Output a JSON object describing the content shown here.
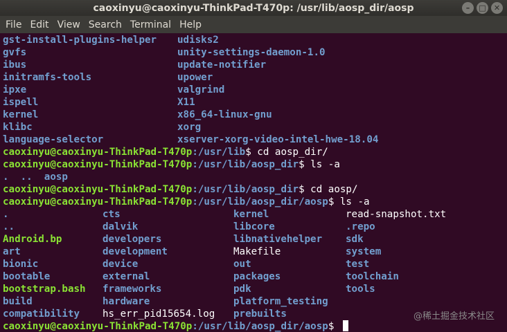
{
  "window": {
    "title": "caoxinyu@caoxinyu-ThinkPad-T470p: /usr/lib/aosp_dir/aosp",
    "buttons": [
      "–",
      "□",
      "✕"
    ]
  },
  "menubar": [
    "File",
    "Edit",
    "View",
    "Search",
    "Terminal",
    "Help"
  ],
  "listing1": [
    [
      "gst-install-plugins-helper",
      "udisks2"
    ],
    [
      "gvfs",
      "unity-settings-daemon-1.0"
    ],
    [
      "ibus",
      "update-notifier"
    ],
    [
      "initramfs-tools",
      "upower"
    ],
    [
      "ipxe",
      "valgrind"
    ],
    [
      "ispell",
      "X11"
    ],
    [
      "kernel",
      "x86_64-linux-gnu"
    ],
    [
      "klibc",
      "xorg"
    ],
    [
      "language-selector",
      "xserver-xorg-video-intel-hwe-18.04"
    ]
  ],
  "prompt_user": "caoxinyu@caoxinyu-ThinkPad-T470p",
  "prompts": [
    {
      "path": ":/usr/lib",
      "cmd": "$ cd aosp_dir/"
    },
    {
      "path": ":/usr/lib/aosp_dir",
      "cmd": "$ ls -a"
    }
  ],
  "listing2": ".  ..  aosp",
  "prompts2": [
    {
      "path": ":/usr/lib/aosp_dir",
      "cmd": "$ cd aosp/"
    },
    {
      "path": ":/usr/lib/aosp_dir/aosp",
      "cmd": "$ ls -a"
    }
  ],
  "listing3": [
    [
      ".",
      "cts",
      "kernel",
      "read-snapshot.txt"
    ],
    [
      "..",
      "dalvik",
      "libcore",
      ".repo"
    ],
    [
      "Android.bp",
      "developers",
      "libnativehelper",
      "sdk"
    ],
    [
      "art",
      "development",
      "Makefile",
      "system"
    ],
    [
      "bionic",
      "device",
      "out",
      "test"
    ],
    [
      "bootable",
      "external",
      "packages",
      "toolchain"
    ],
    [
      "bootstrap.bash",
      "frameworks",
      "pdk",
      "tools"
    ],
    [
      "build",
      "hardware",
      "platform_testing",
      ""
    ],
    [
      "compatibility",
      "hs_err_pid15654.log",
      "prebuilts",
      ""
    ]
  ],
  "last_prompt": {
    "path": ":/usr/lib/aosp_dir/aosp",
    "cmd": "$ "
  },
  "watermark": "@稀土掘金技术社区",
  "colors": {
    "background": "#300a24",
    "user": "#8ae234",
    "dir": "#729fcf",
    "text": "#ffffff"
  }
}
